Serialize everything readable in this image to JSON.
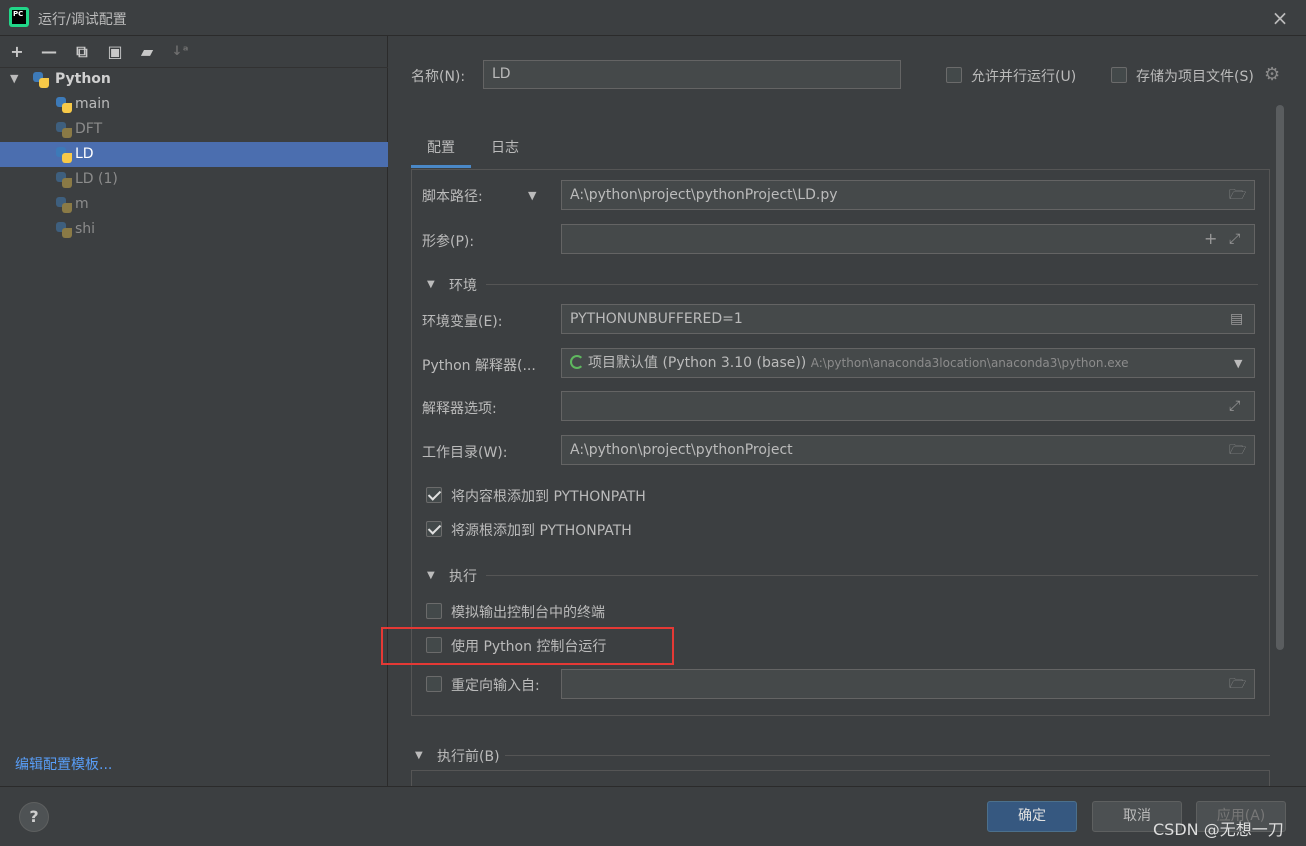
{
  "window": {
    "title": "运行/调试配置",
    "close_icon": "×",
    "logo_text": "PC"
  },
  "toolbar": {
    "icons": [
      "add-icon",
      "remove-icon",
      "copy-icon",
      "save-icon",
      "new-folder-icon",
      "sort-icon"
    ],
    "add": "+",
    "remove": "—",
    "copy": "⧉",
    "save": "▣",
    "folder": "▰",
    "sort": "↓ᵃ"
  },
  "tree": {
    "root_label": "Python",
    "items": [
      {
        "label": "main",
        "dim": false
      },
      {
        "label": "DFT",
        "dim": true
      },
      {
        "label": "LD",
        "dim": false,
        "selected": true
      },
      {
        "label": "LD (1)",
        "dim": true
      },
      {
        "label": "m",
        "dim": true
      },
      {
        "label": "shi",
        "dim": true
      }
    ]
  },
  "edit_templates": "编辑配置模板...",
  "name_field": {
    "label": "名称(N):",
    "value": "LD"
  },
  "allow_parallel": {
    "label": "允许并行运行(U)",
    "checked": false
  },
  "store_as_project": {
    "label": "存储为项目文件(S)",
    "checked": false
  },
  "tabs": [
    {
      "label": "配置"
    },
    {
      "label": "日志"
    }
  ],
  "fields": {
    "script_path": {
      "label": "脚本路径:",
      "value": "A:\\python\\project\\pythonProject\\LD.py"
    },
    "params": {
      "label": "形参(P):",
      "value": ""
    },
    "env_section": "环境",
    "env_vars": {
      "label": "环境变量(E):",
      "value": "PYTHONUNBUFFERED=1"
    },
    "interpreter": {
      "label": "Python 解释器(...",
      "value": "项目默认值 (Python 3.10 (base))",
      "path": "A:\\python\\anaconda3location\\anaconda3\\python.exe"
    },
    "interp_options": {
      "label": "解释器选项:",
      "value": ""
    },
    "working_dir": {
      "label": "工作目录(W):",
      "value": "A:\\python\\project\\pythonProject"
    },
    "add_content_roots": {
      "label": "将内容根添加到 PYTHONPATH",
      "checked": true
    },
    "add_source_roots": {
      "label": "将源根添加到 PYTHONPATH",
      "checked": true
    },
    "exec_section": "执行",
    "emulate_terminal": {
      "label": "模拟输出控制台中的终端",
      "checked": false
    },
    "python_console": {
      "label": "使用 Python 控制台运行",
      "checked": false
    },
    "redirect_input": {
      "label": "重定向输入自:",
      "checked": false,
      "value": ""
    },
    "before_launch": "执行前(B)"
  },
  "buttons": {
    "help": "?",
    "ok": "确定",
    "cancel": "取消",
    "apply": "应用(A)"
  },
  "watermark": "CSDN @无想一刀",
  "colors": {
    "selection": "#4b6eaf",
    "highlight": "#e53935",
    "link": "#589df6",
    "primary": "#365880"
  }
}
